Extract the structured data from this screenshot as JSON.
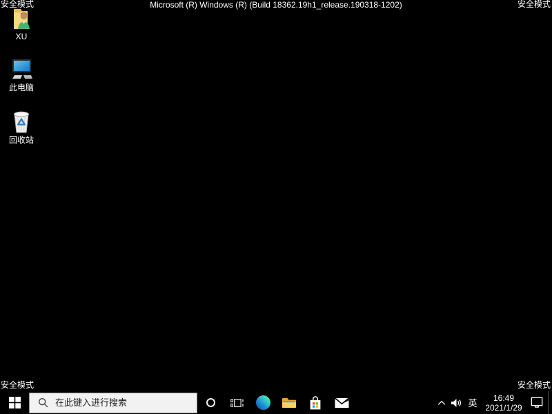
{
  "system": {
    "safe_mode_label": "安全模式",
    "build_text": "Microsoft (R) Windows (R) (Build 18362.19h1_release.190318-1202)"
  },
  "desktop": {
    "icons": [
      {
        "name": "user-files-folder",
        "label": "XU"
      },
      {
        "name": "this-pc",
        "label": "此电脑"
      },
      {
        "name": "recycle-bin",
        "label": "回收站"
      }
    ]
  },
  "taskbar": {
    "search": {
      "placeholder": "在此键入进行搜索"
    },
    "app_icons": [
      "start",
      "cortana",
      "task-view",
      "edge",
      "file-explorer",
      "store",
      "mail"
    ],
    "tray": {
      "icons": [
        "chevron-up",
        "speaker",
        "ime",
        "clock",
        "action-center",
        "show-desktop"
      ],
      "ime_label": "英",
      "time": "16:49",
      "date": "2021/1/29"
    }
  },
  "colors": {
    "desktop_bg": "#000000",
    "taskbar_bg": "#000000",
    "search_box_bg": "#f2f2f2",
    "text": "#ffffff",
    "ms_red": "#f25022",
    "ms_green": "#7fba00",
    "ms_blue": "#00a4ef",
    "ms_yellow": "#ffb900",
    "folder_yellow": "#ffd45e",
    "recycle_blue": "#2f7fc4"
  }
}
